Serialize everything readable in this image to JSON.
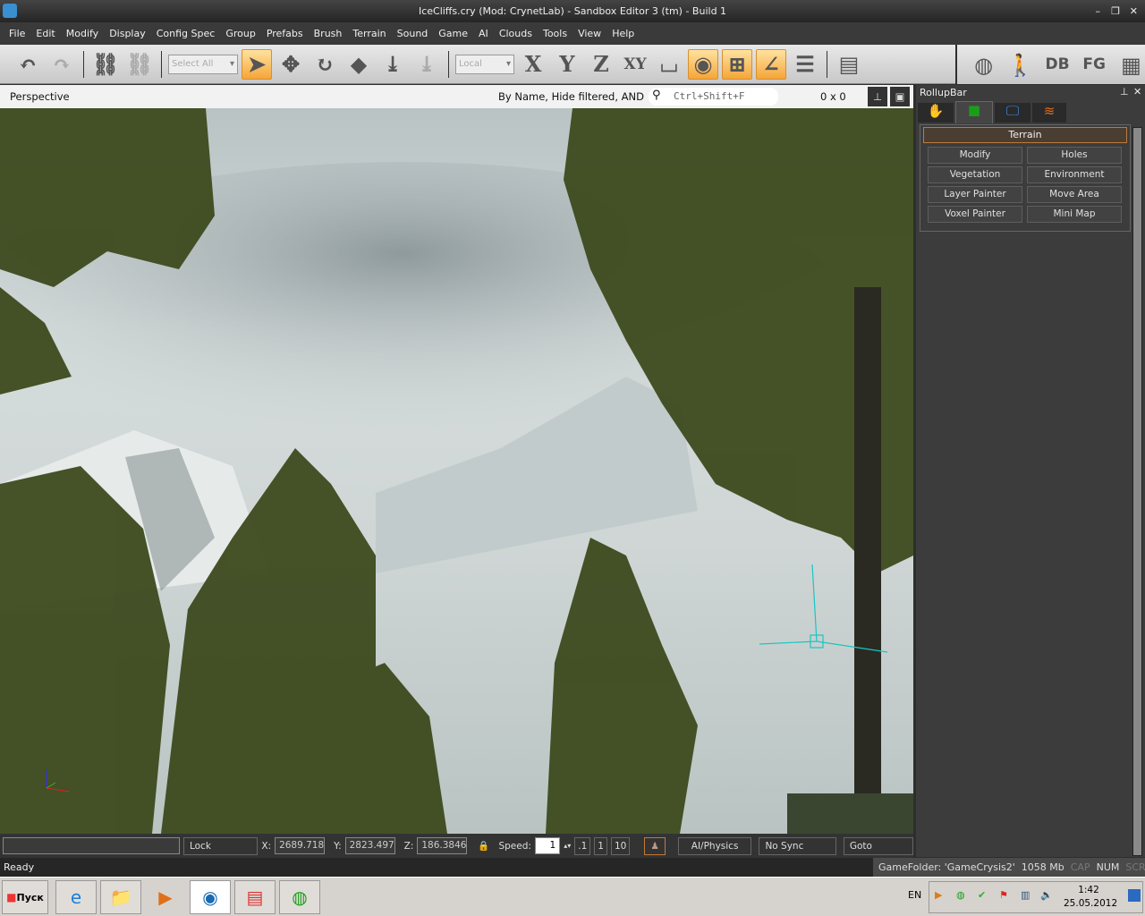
{
  "window": {
    "title": "IceCliffs.cry (Mod: CrynetLab) - Sandbox Editor 3 (tm) - Build 1"
  },
  "menu": [
    "File",
    "Edit",
    "Modify",
    "Display",
    "Config Spec",
    "Group",
    "Prefabs",
    "Brush",
    "Terrain",
    "Sound",
    "Game",
    "AI",
    "Clouds",
    "Tools",
    "View",
    "Help"
  ],
  "toolbar": {
    "select_combo": "Select All",
    "coord_combo": "Local",
    "axis_x": "X",
    "axis_y": "Y",
    "axis_z": "Z",
    "axis_xy": "XY",
    "db": "DB",
    "fg": "FG"
  },
  "viewport": {
    "name": "Perspective",
    "filter": "By Name, Hide filtered, AND",
    "search_placeholder": "Ctrl+Shift+F",
    "resolution": "0 x 0"
  },
  "rollup": {
    "title": "RollupBar",
    "section": "Terrain",
    "buttons": [
      "Modify",
      "Holes",
      "Vegetation",
      "Environment",
      "Layer Painter",
      "Move Area",
      "Voxel Painter",
      "Mini Map"
    ]
  },
  "bottom": {
    "lock_selection": "Lock Selection",
    "x_label": "X:",
    "x": "2689.718",
    "y_label": "Y:",
    "y": "2823.497",
    "z_label": "Z:",
    "z": "186.3846",
    "speed_label": "Speed:",
    "speed": "1",
    "speed_presets": [
      ".1",
      "1",
      "10"
    ],
    "ai_physics": "AI/Physics",
    "no_sync": "No Sync Player",
    "goto": "Goto position"
  },
  "status": {
    "text": "Ready",
    "game_folder": "GameFolder: 'GameCrysis2'",
    "memory": "1058 Mb",
    "cap": "CAP",
    "num": "NUM",
    "scrl": "SCRL"
  },
  "taskbar": {
    "start": "Пуск",
    "lang": "EN",
    "time": "1:42",
    "date": "25.05.2012"
  }
}
